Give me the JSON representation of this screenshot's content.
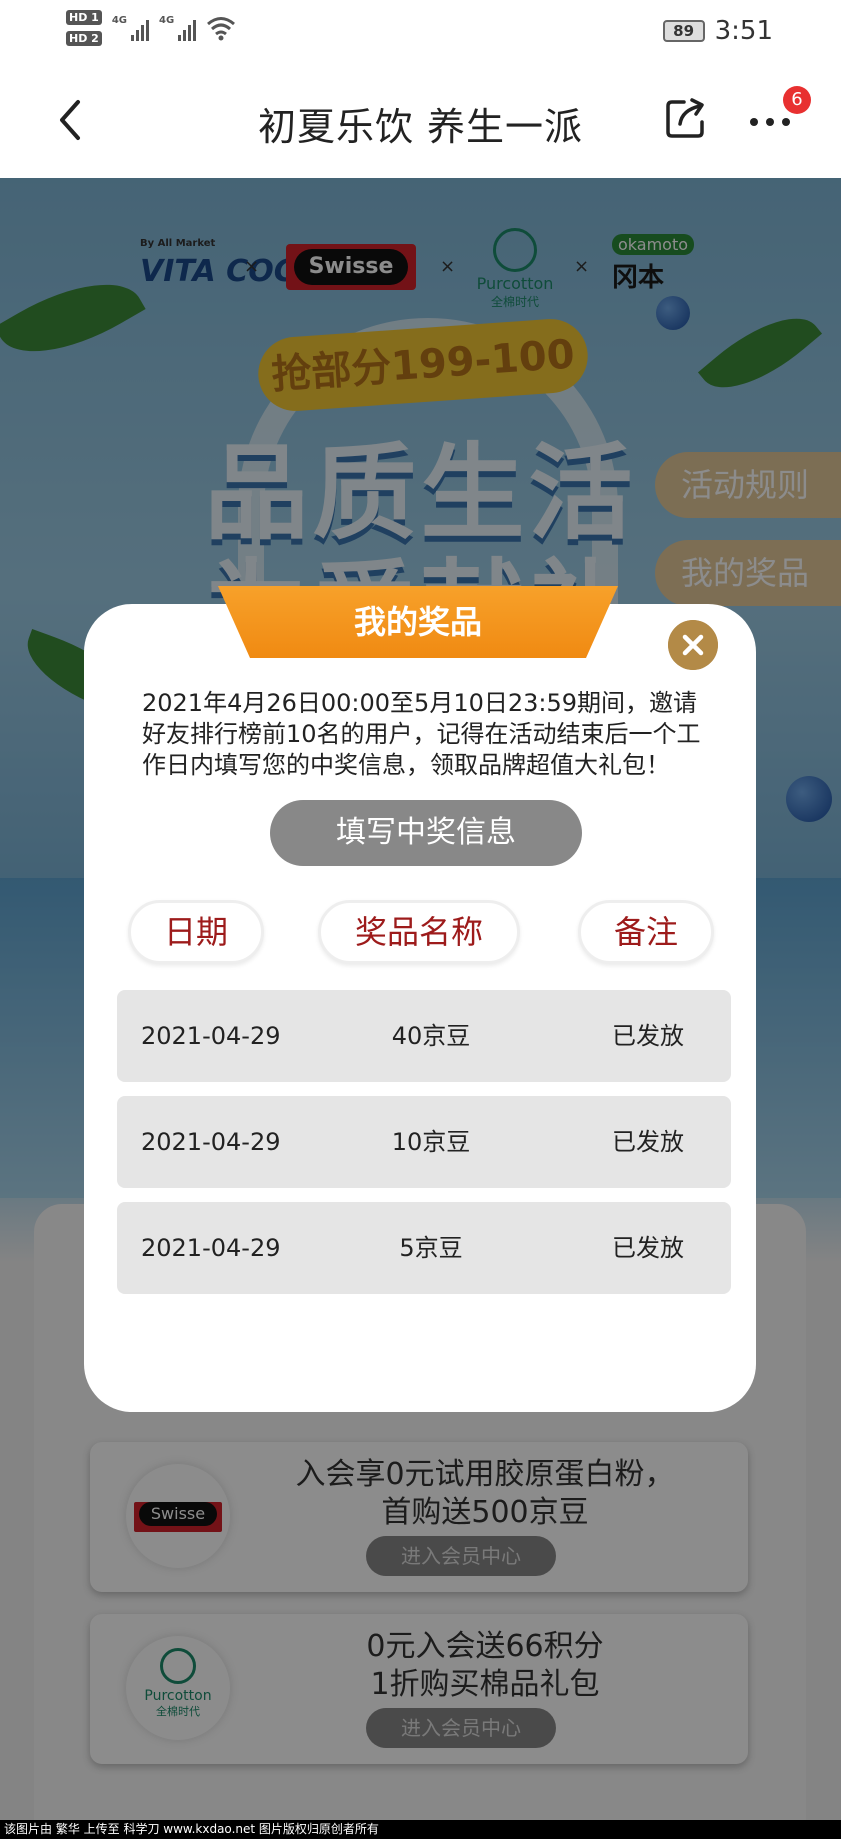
{
  "status_bar": {
    "hd1": "HD 1",
    "hd2": "HD 2",
    "net1": "4G",
    "net2": "4G",
    "battery": "89",
    "time": "3:51"
  },
  "nav": {
    "title": "初夏乐饮 养生一派",
    "badge": "6"
  },
  "background": {
    "brands": [
      "VITA COCO",
      "Swisse",
      "Purcotton",
      "okamoto"
    ],
    "brand_cn": {
      "purcotton": "全棉时代",
      "okamoto": "冈本"
    },
    "by_all_market": "By All Market",
    "separator": "×",
    "promo": "抢部分199-100",
    "headline1": "品质生活",
    "headline2": "为爱献礼",
    "side_rules": "活动规则",
    "side_prizes": "我的奖品",
    "members": [
      {
        "line1": "入会享0元试用胶原蛋白粉，",
        "line2": "首购送500京豆",
        "cta": "进入会员中心",
        "brand": "Swisse"
      },
      {
        "line1": "0元入会送66积分",
        "line2": "1折购买棉品礼包",
        "cta": "进入会员中心",
        "brand": "Purcotton",
        "brand_cn": "全棉时代"
      }
    ],
    "footer": "该图片由 繁华 上传至 科学刀 www.kxdao.net 图片版权归原创者所有"
  },
  "modal": {
    "title": "我的奖品",
    "description": "2021年4月26日00:00至5月10日23:59期间，邀请好友排行榜前10名的用户，记得在活动结束后一个工作日内填写您的中奖信息，领取品牌超值大礼包！",
    "fill_button": "填写中奖信息",
    "headers": [
      "日期",
      "奖品名称",
      "备注"
    ],
    "rows": [
      {
        "date": "2021-04-29",
        "prize": "40京豆",
        "note": "已发放"
      },
      {
        "date": "2021-04-29",
        "prize": "10京豆",
        "note": "已发放"
      },
      {
        "date": "2021-04-29",
        "prize": "5京豆",
        "note": "已发放"
      }
    ]
  }
}
